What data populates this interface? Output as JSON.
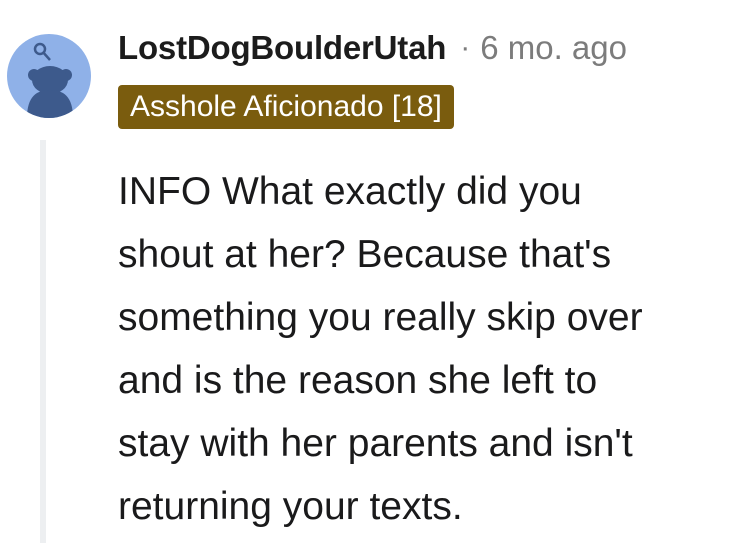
{
  "comment": {
    "username": "LostDogBoulderUtah",
    "separator": "·",
    "timestamp": "6 mo. ago",
    "flair": "Asshole Aficionado [18]",
    "body_lines": [
      "INFO What exactly did you",
      "shout at her? Because that's",
      "something you really skip over",
      "and is the reason she left to",
      "stay with her parents and isn't",
      "returning your texts."
    ]
  },
  "colors": {
    "avatar_bg": "#8fb1e8",
    "avatar_figure": "#3d5a8c",
    "flair_bg": "#7a5c0e",
    "flair_text": "#ffffff",
    "meta_text": "#7c7c7c",
    "thread_line": "#edeff1"
  }
}
